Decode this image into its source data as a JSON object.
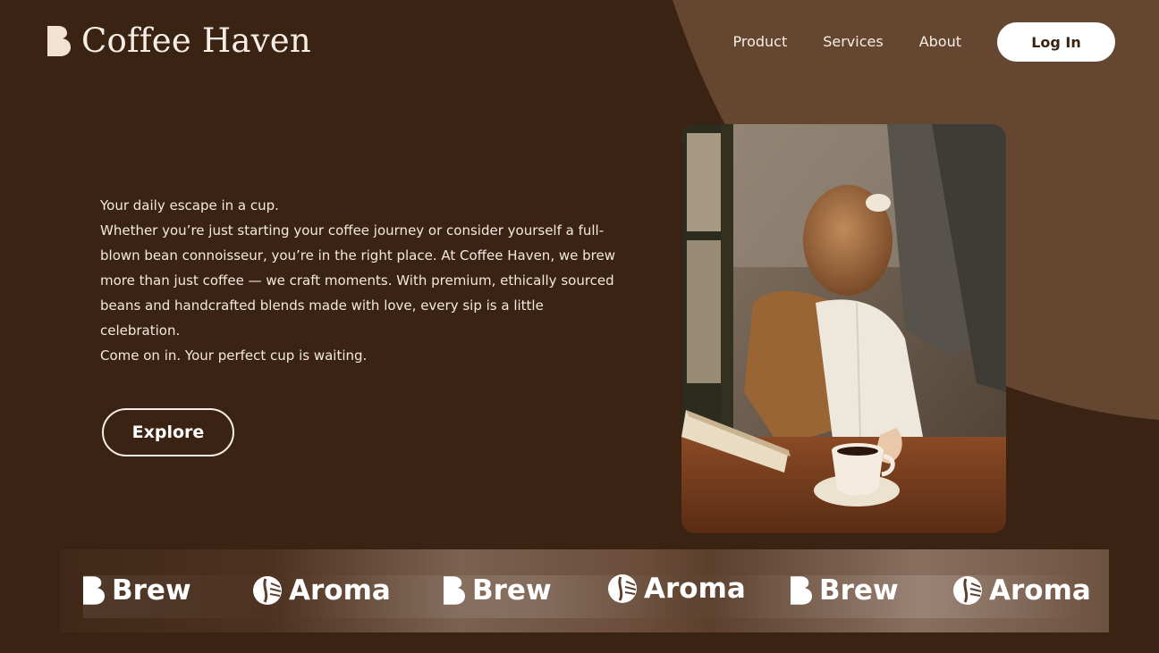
{
  "header": {
    "brand": "Coffee Haven",
    "nav": [
      "Product",
      "Services",
      "About"
    ],
    "login_label": "Log In"
  },
  "hero": {
    "paragraphs": [
      "Your daily escape in a cup.",
      "Whether you’re just starting your coffee journey or consider yourself a full-blown bean connoisseur, you’re in the right place. At Coffee Haven, we brew more than just coffee — we craft moments. With premium, ethically sourced beans and handcrafted blends made with love, every sip is a little celebration.",
      "Come on in. Your perfect cup is waiting."
    ],
    "cta_label": "Explore"
  },
  "photo": {
    "icon": "woman-with-coffee-photo"
  },
  "logo_strip": {
    "items": [
      {
        "name": "Brew",
        "icon": "b-mark-icon"
      },
      {
        "name": "Aroma",
        "icon": "bean-circle-icon"
      },
      {
        "name": "Brew",
        "icon": "b-mark-icon"
      },
      {
        "name": "Aroma",
        "icon": "bean-circle-icon"
      },
      {
        "name": "Brew",
        "icon": "b-mark-icon"
      },
      {
        "name": "Aroma",
        "icon": "bean-circle-icon"
      }
    ]
  },
  "colors": {
    "background": "#3b2313",
    "accent_curve": "#654630",
    "text_light": "#f6eee6",
    "button_bg": "#ffffff"
  }
}
